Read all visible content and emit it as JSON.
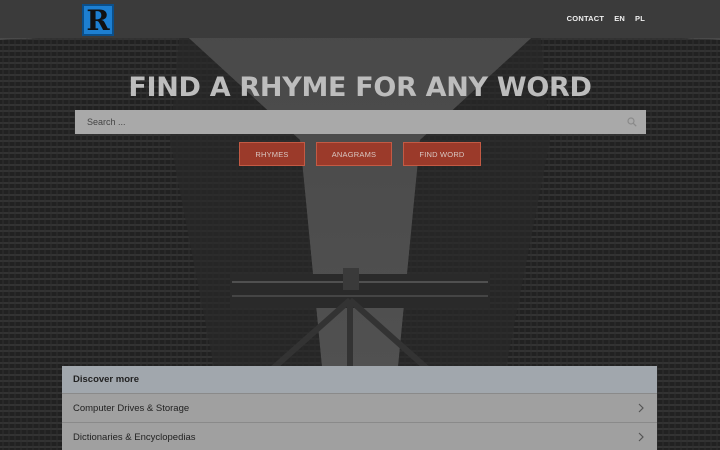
{
  "header": {
    "logo_letter": "R",
    "nav": [
      {
        "label": "CONTACT"
      },
      {
        "label": "EN"
      },
      {
        "label": "PL"
      }
    ]
  },
  "hero": {
    "title": "FIND A RHYME FOR ANY WORD",
    "search_placeholder": "Search ...",
    "buttons": [
      {
        "label": "RHYMES"
      },
      {
        "label": "ANAGRAMS"
      },
      {
        "label": "FIND WORD"
      }
    ]
  },
  "discover": {
    "heading": "Discover more",
    "items": [
      {
        "label": "Computer Drives & Storage"
      },
      {
        "label": "Dictionaries & Encyclopedias"
      }
    ]
  }
}
